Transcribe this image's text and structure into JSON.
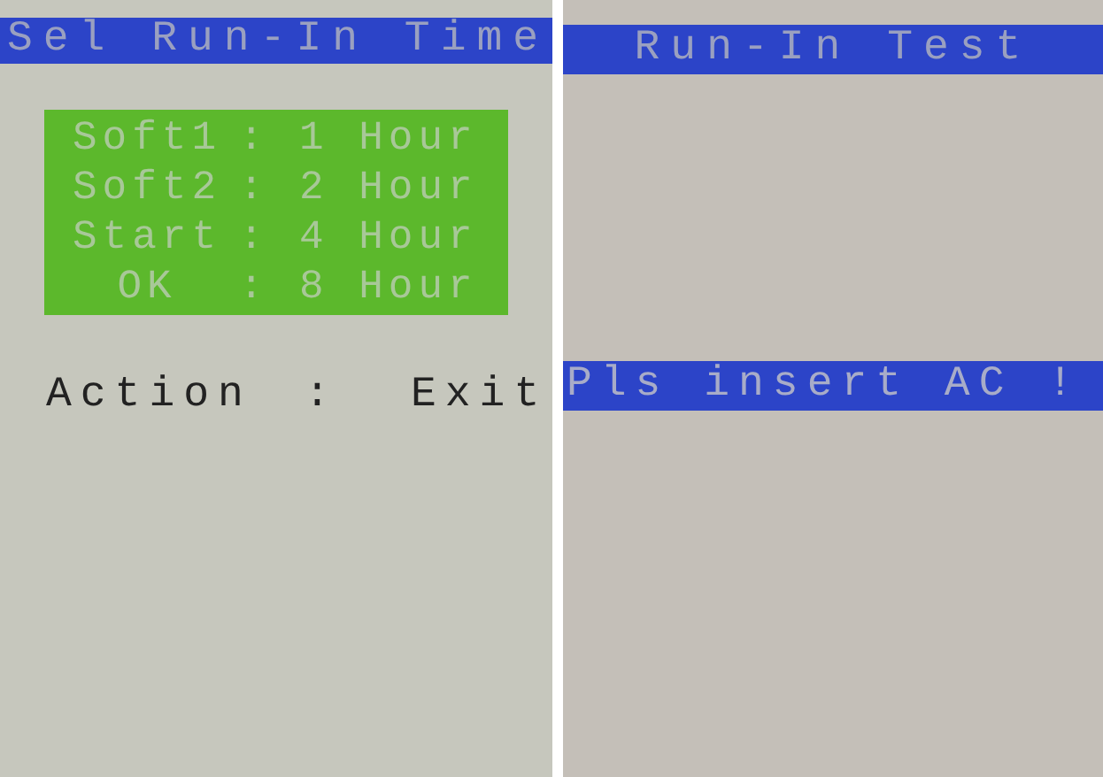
{
  "left_screen": {
    "title": "Sel Run-In Time",
    "menu": [
      {
        "label": "Soft1",
        "separator": ":",
        "value": "1 Hour"
      },
      {
        "label": "Soft2",
        "separator": ":",
        "value": "2 Hour"
      },
      {
        "label": "Start",
        "separator": ":",
        "value": "4 Hour"
      },
      {
        "label": "OK",
        "separator": ":",
        "value": "8 Hour"
      }
    ],
    "action": {
      "label": "Action",
      "separator": ":",
      "value": "Exit"
    }
  },
  "right_screen": {
    "title": "Run-In Test",
    "message": "Pls insert AC !"
  }
}
